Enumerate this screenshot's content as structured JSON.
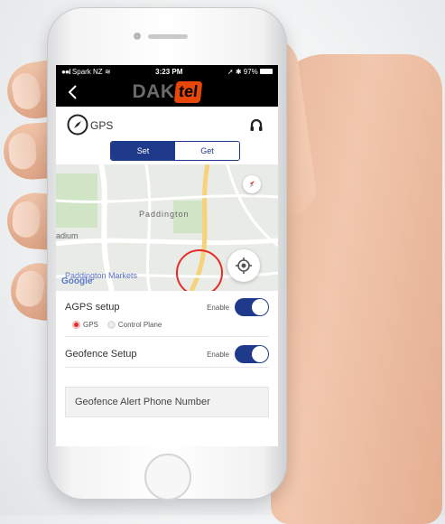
{
  "status_bar": {
    "carrier": "Spark NZ",
    "time": "3:23 PM",
    "battery": "97%"
  },
  "header": {
    "logo_main": "DAK",
    "logo_accent": "tel"
  },
  "gps": {
    "title": "GPS",
    "set_label": "Set",
    "get_label": "Get"
  },
  "map": {
    "label_paddington": "Paddington",
    "label_stadium": "adium",
    "label_markets": "Paddington Markets",
    "google_label": "Google"
  },
  "agps": {
    "title": "AGPS setup",
    "enable_label": "Enable",
    "option_gps": "GPS",
    "option_control_plane": "Control Plane",
    "selected": "GPS",
    "enabled": true
  },
  "geofence": {
    "title": "Geofence Setup",
    "enable_label": "Enable",
    "enabled": true
  },
  "geofence_phone": {
    "label": "Geofence Alert Phone Number"
  },
  "colors": {
    "accent": "#1f3a8a",
    "brand": "#e8470a",
    "marker": "#e52c2c"
  }
}
